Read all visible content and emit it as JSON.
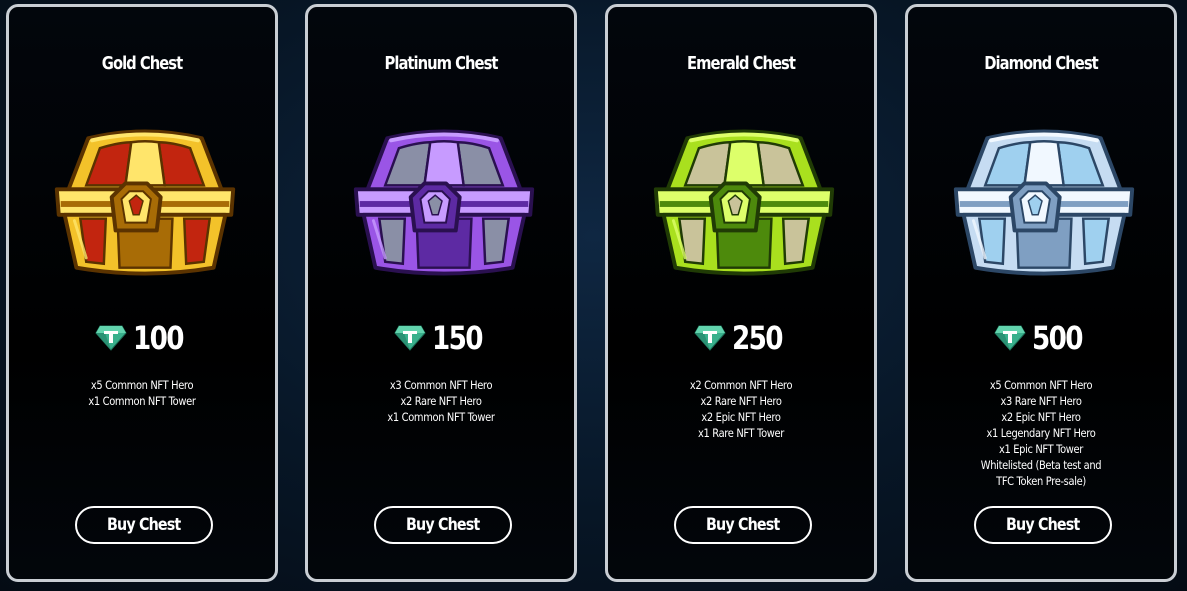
{
  "chests": [
    {
      "title": "Gold Chest",
      "icon": "gold-chest-icon",
      "price": "100",
      "currency_icon": "tether-gem-icon",
      "rewards": [
        "x5 Common NFT Hero",
        "x1 Common NFT Tower"
      ],
      "button": "Buy Chest",
      "colors": {
        "main": "#f3c22a",
        "light": "#ffe56b",
        "dark": "#a86c06",
        "inner": "#c2250f",
        "outline": "#5b3300"
      }
    },
    {
      "title": "Platinum Chest",
      "icon": "platinum-chest-icon",
      "price": "150",
      "currency_icon": "tether-gem-icon",
      "rewards": [
        "x3 Common NFT Hero",
        "x2 Rare NFT Hero",
        "x1 Common NFT Tower"
      ],
      "button": "Buy Chest",
      "colors": {
        "main": "#9a55e6",
        "light": "#c79bff",
        "dark": "#5d2aa3",
        "inner": "#8a8fa6",
        "outline": "#2a1050"
      }
    },
    {
      "title": "Emerald Chest",
      "icon": "emerald-chest-icon",
      "price": "250",
      "currency_icon": "tether-gem-icon",
      "rewards": [
        "x2 Common NFT Hero",
        "x2 Rare NFT Hero",
        "x2 Epic NFT Hero",
        "x1 Rare NFT Tower"
      ],
      "button": "Buy Chest",
      "colors": {
        "main": "#a9e01e",
        "light": "#ddff6a",
        "dark": "#4d8a0c",
        "inner": "#c9c39a",
        "outline": "#203b05"
      }
    },
    {
      "title": "Diamond Chest",
      "icon": "diamond-chest-icon",
      "price": "500",
      "currency_icon": "tether-gem-icon",
      "rewards": [
        "x5 Common NFT Hero",
        "x3 Rare NFT Hero",
        "x2 Epic NFT Hero",
        "x1 Legendary NFT Hero",
        "x1 Epic NFT Tower",
        "Whitelisted (Beta test and",
        "TFC Token Pre-sale)"
      ],
      "button": "Buy Chest",
      "colors": {
        "main": "#c6dcf2",
        "light": "#f1f8ff",
        "dark": "#7f9fc2",
        "inner": "#9fd0ef",
        "outline": "#2c4766"
      }
    }
  ]
}
